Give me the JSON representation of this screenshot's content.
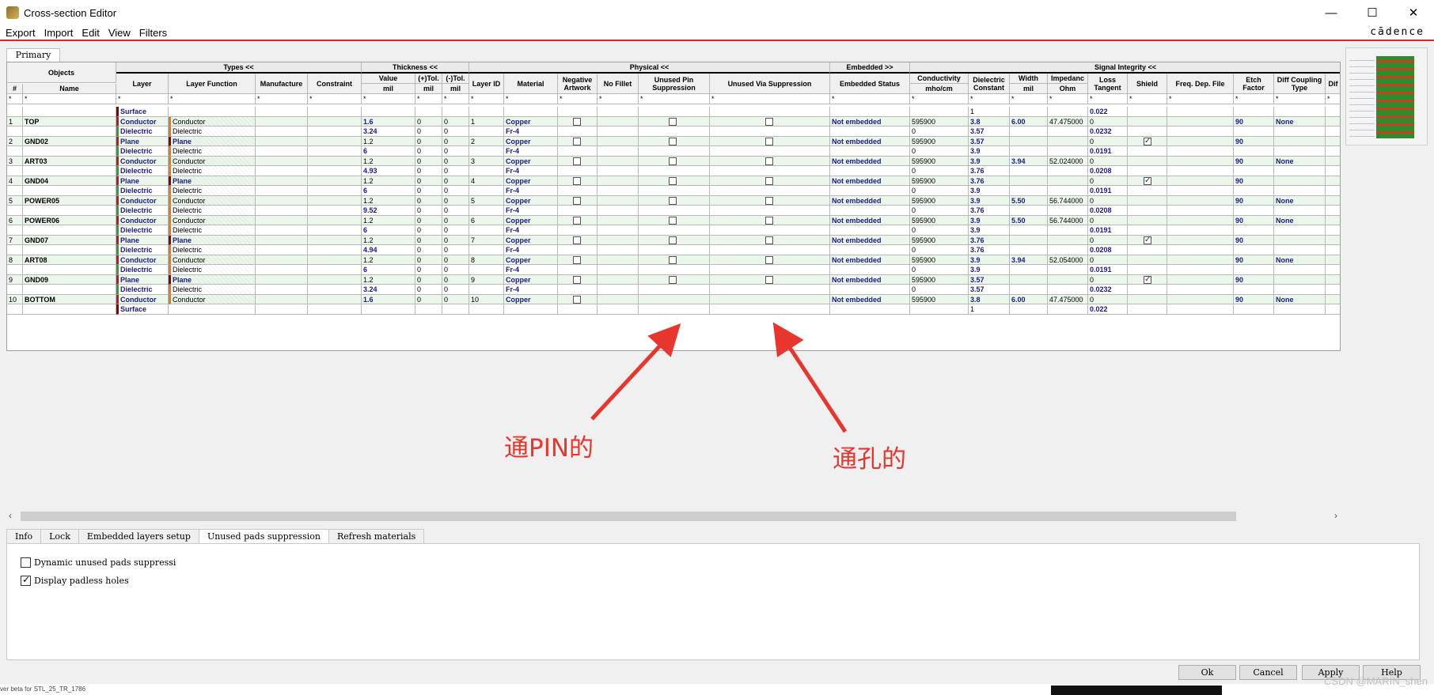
{
  "window": {
    "title": "Cross-section Editor",
    "controls": [
      "—",
      "☐",
      "✕"
    ]
  },
  "menu": [
    "Export",
    "Import",
    "Edit",
    "View",
    "Filters"
  ],
  "brand": "cādence",
  "primary_tab": "Primary",
  "groups": {
    "objects": "Objects",
    "types": "Types <<",
    "thickness": "Thickness <<",
    "physical": "Physical <<",
    "embedded": "Embedded >>",
    "signal": "Signal Integrity <<"
  },
  "headers": {
    "num": "#",
    "name": "Name",
    "layer": "Layer",
    "layer_function": "Layer Function",
    "manufacture": "Manufacture",
    "constraint": "Constraint",
    "value": "Value",
    "value_unit": "mil",
    "tol_plus": "(+)Tol.",
    "tol_plus_unit": "mil",
    "tol_minus": "(-)Tol.",
    "tol_minus_unit": "mil",
    "layer_id": "Layer ID",
    "material": "Material",
    "neg_artwork": "Negative Artwork",
    "no_fillet": "No Fillet",
    "unused_pin": "Unused Pin Suppression",
    "unused_via": "Unused Via Suppression",
    "embedded_status": "Embedded Status",
    "conductivity": "Conductivity",
    "conductivity_unit": "mho/cm",
    "dielectric": "Dielectric Constant",
    "width": "Width",
    "width_unit": "mil",
    "impedance": "Impedanc",
    "impedance_unit": "Ohm",
    "loss_tangent": "Loss Tangent",
    "shield": "Shield",
    "freq_dep": "Freq. Dep. File",
    "etch_factor": "Etch Factor",
    "diff_coupling": "Diff Coupling Type",
    "dif_trunc": "Dif"
  },
  "filter_star": "*",
  "rows": [
    {
      "num": "",
      "name": "",
      "layer": "Surface",
      "kind": "surface",
      "dielectric": "1",
      "loss": "0.022"
    },
    {
      "num": "1",
      "name": "TOP",
      "layer": "Conductor",
      "func": "Conductor",
      "kind": "conductor",
      "value": "1.6",
      "vbold": true,
      "tp": "0",
      "tm": "0",
      "lid": "1",
      "mat": "Copper",
      "emb": "Not embedded",
      "cond": "595900",
      "dielectric": "3.8",
      "width": "6.00",
      "imp": "47.475000",
      "loss": "0",
      "etch": "90",
      "diff": "None"
    },
    {
      "num": "",
      "name": "",
      "layer": "Dielectric",
      "func": "Dielectric",
      "kind": "dielectric",
      "value": "3.24",
      "vbold": true,
      "tp": "0",
      "tm": "0",
      "mat": "Fr-4",
      "cond": "0",
      "dielectric": "3.57",
      "loss": "0.0232"
    },
    {
      "num": "2",
      "name": "GND02",
      "layer": "Plane",
      "func": "Plane",
      "kind": "plane",
      "value": "1.2",
      "tp": "0",
      "tm": "0",
      "lid": "2",
      "mat": "Copper",
      "emb": "Not embedded",
      "cond": "595900",
      "dielectric": "3.57",
      "loss": "0",
      "shield": true,
      "etch": "90"
    },
    {
      "num": "",
      "name": "",
      "layer": "Dielectric",
      "func": "Dielectric",
      "kind": "dielectric",
      "value": "6",
      "vbold": true,
      "tp": "0",
      "tm": "0",
      "mat": "Fr-4",
      "cond": "0",
      "dielectric": "3.9",
      "loss": "0.0191"
    },
    {
      "num": "3",
      "name": "ART03",
      "layer": "Conductor",
      "func": "Conductor",
      "kind": "conductor",
      "value": "1.2",
      "tp": "0",
      "tm": "0",
      "lid": "3",
      "mat": "Copper",
      "emb": "Not embedded",
      "cond": "595900",
      "dielectric": "3.9",
      "width": "3.94",
      "imp": "52.024000",
      "loss": "0",
      "etch": "90",
      "diff": "None"
    },
    {
      "num": "",
      "name": "",
      "layer": "Dielectric",
      "func": "Dielectric",
      "kind": "dielectric",
      "value": "4.93",
      "vbold": true,
      "tp": "0",
      "tm": "0",
      "mat": "Fr-4",
      "cond": "0",
      "dielectric": "3.76",
      "loss": "0.0208"
    },
    {
      "num": "4",
      "name": "GND04",
      "layer": "Plane",
      "func": "Plane",
      "kind": "plane",
      "value": "1.2",
      "tp": "0",
      "tm": "0",
      "lid": "4",
      "mat": "Copper",
      "emb": "Not embedded",
      "cond": "595900",
      "dielectric": "3.76",
      "loss": "0",
      "shield": true,
      "etch": "90"
    },
    {
      "num": "",
      "name": "",
      "layer": "Dielectric",
      "func": "Dielectric",
      "kind": "dielectric",
      "value": "6",
      "vbold": true,
      "tp": "0",
      "tm": "0",
      "mat": "Fr-4",
      "cond": "0",
      "dielectric": "3.9",
      "loss": "0.0191"
    },
    {
      "num": "5",
      "name": "POWER05",
      "layer": "Conductor",
      "func": "Conductor",
      "kind": "conductor",
      "value": "1.2",
      "tp": "0",
      "tm": "0",
      "lid": "5",
      "mat": "Copper",
      "emb": "Not embedded",
      "cond": "595900",
      "dielectric": "3.9",
      "width": "5.50",
      "imp": "56.744000",
      "loss": "0",
      "etch": "90",
      "diff": "None"
    },
    {
      "num": "",
      "name": "",
      "layer": "Dielectric",
      "func": "Dielectric",
      "kind": "dielectric",
      "value": "9.52",
      "vbold": true,
      "tp": "0",
      "tm": "0",
      "mat": "Fr-4",
      "cond": "0",
      "dielectric": "3.76",
      "loss": "0.0208"
    },
    {
      "num": "6",
      "name": "POWER06",
      "layer": "Conductor",
      "func": "Conductor",
      "kind": "conductor",
      "value": "1.2",
      "tp": "0",
      "tm": "0",
      "lid": "6",
      "mat": "Copper",
      "emb": "Not embedded",
      "cond": "595900",
      "dielectric": "3.9",
      "width": "5.50",
      "imp": "56.744000",
      "loss": "0",
      "etch": "90",
      "diff": "None"
    },
    {
      "num": "",
      "name": "",
      "layer": "Dielectric",
      "func": "Dielectric",
      "kind": "dielectric",
      "value": "6",
      "vbold": true,
      "tp": "0",
      "tm": "0",
      "mat": "Fr-4",
      "cond": "0",
      "dielectric": "3.9",
      "loss": "0.0191"
    },
    {
      "num": "7",
      "name": "GND07",
      "layer": "Plane",
      "func": "Plane",
      "kind": "plane",
      "value": "1.2",
      "tp": "0",
      "tm": "0",
      "lid": "7",
      "mat": "Copper",
      "emb": "Not embedded",
      "cond": "595900",
      "dielectric": "3.76",
      "loss": "0",
      "shield": true,
      "etch": "90"
    },
    {
      "num": "",
      "name": "",
      "layer": "Dielectric",
      "func": "Dielectric",
      "kind": "dielectric",
      "value": "4.94",
      "vbold": true,
      "tp": "0",
      "tm": "0",
      "mat": "Fr-4",
      "cond": "0",
      "dielectric": "3.76",
      "loss": "0.0208"
    },
    {
      "num": "8",
      "name": "ART08",
      "layer": "Conductor",
      "func": "Conductor",
      "kind": "conductor",
      "value": "1.2",
      "tp": "0",
      "tm": "0",
      "lid": "8",
      "mat": "Copper",
      "emb": "Not embedded",
      "cond": "595900",
      "dielectric": "3.9",
      "width": "3.94",
      "imp": "52.054000",
      "loss": "0",
      "etch": "90",
      "diff": "None"
    },
    {
      "num": "",
      "name": "",
      "layer": "Dielectric",
      "func": "Dielectric",
      "kind": "dielectric",
      "value": "6",
      "vbold": true,
      "tp": "0",
      "tm": "0",
      "mat": "Fr-4",
      "cond": "0",
      "dielectric": "3.9",
      "loss": "0.0191"
    },
    {
      "num": "9",
      "name": "GND09",
      "layer": "Plane",
      "func": "Plane",
      "kind": "plane",
      "value": "1.2",
      "tp": "0",
      "tm": "0",
      "lid": "9",
      "mat": "Copper",
      "emb": "Not embedded",
      "cond": "595900",
      "dielectric": "3.57",
      "loss": "0",
      "shield": true,
      "etch": "90"
    },
    {
      "num": "",
      "name": "",
      "layer": "Dielectric",
      "func": "Dielectric",
      "kind": "dielectric",
      "value": "3.24",
      "vbold": true,
      "tp": "0",
      "tm": "0",
      "mat": "Fr-4",
      "cond": "0",
      "dielectric": "3.57",
      "loss": "0.0232"
    },
    {
      "num": "10",
      "name": "BOTTOM",
      "layer": "Conductor",
      "func": "Conductor",
      "kind": "conductor",
      "value": "1.6",
      "vbold": true,
      "tp": "0",
      "tm": "0",
      "lid": "10",
      "mat": "Copper",
      "emb": "Not embedded",
      "cond": "595900",
      "dielectric": "3.8",
      "width": "6.00",
      "imp": "47.475000",
      "loss": "0",
      "etch": "90",
      "diff": "None"
    },
    {
      "num": "",
      "name": "",
      "layer": "Surface",
      "kind": "surface",
      "dielectric": "1",
      "loss": "0.022"
    }
  ],
  "bottom_tabs": [
    "Info",
    "Lock",
    "Embedded layers setup",
    "Unused pads suppression",
    "Refresh materials"
  ],
  "active_bottom_tab": 3,
  "options": [
    {
      "label": "Dynamic unused pads suppressi",
      "checked": false
    },
    {
      "label": "Display padless holes",
      "checked": true
    }
  ],
  "buttons": [
    "Ok",
    "Cancel",
    "Apply",
    "Help"
  ],
  "annotations": {
    "pin": "通PIN的",
    "via": "通孔的"
  },
  "watermark": "CSDN @MARIN_shen",
  "status_fragment": "ver beta for STL_25_TR_1786",
  "colors": {
    "accent_red": "#d8262c",
    "annotation_red": "#e8362e",
    "row_green": "#eaf7ea",
    "value_blue": "#1a1a8c"
  }
}
